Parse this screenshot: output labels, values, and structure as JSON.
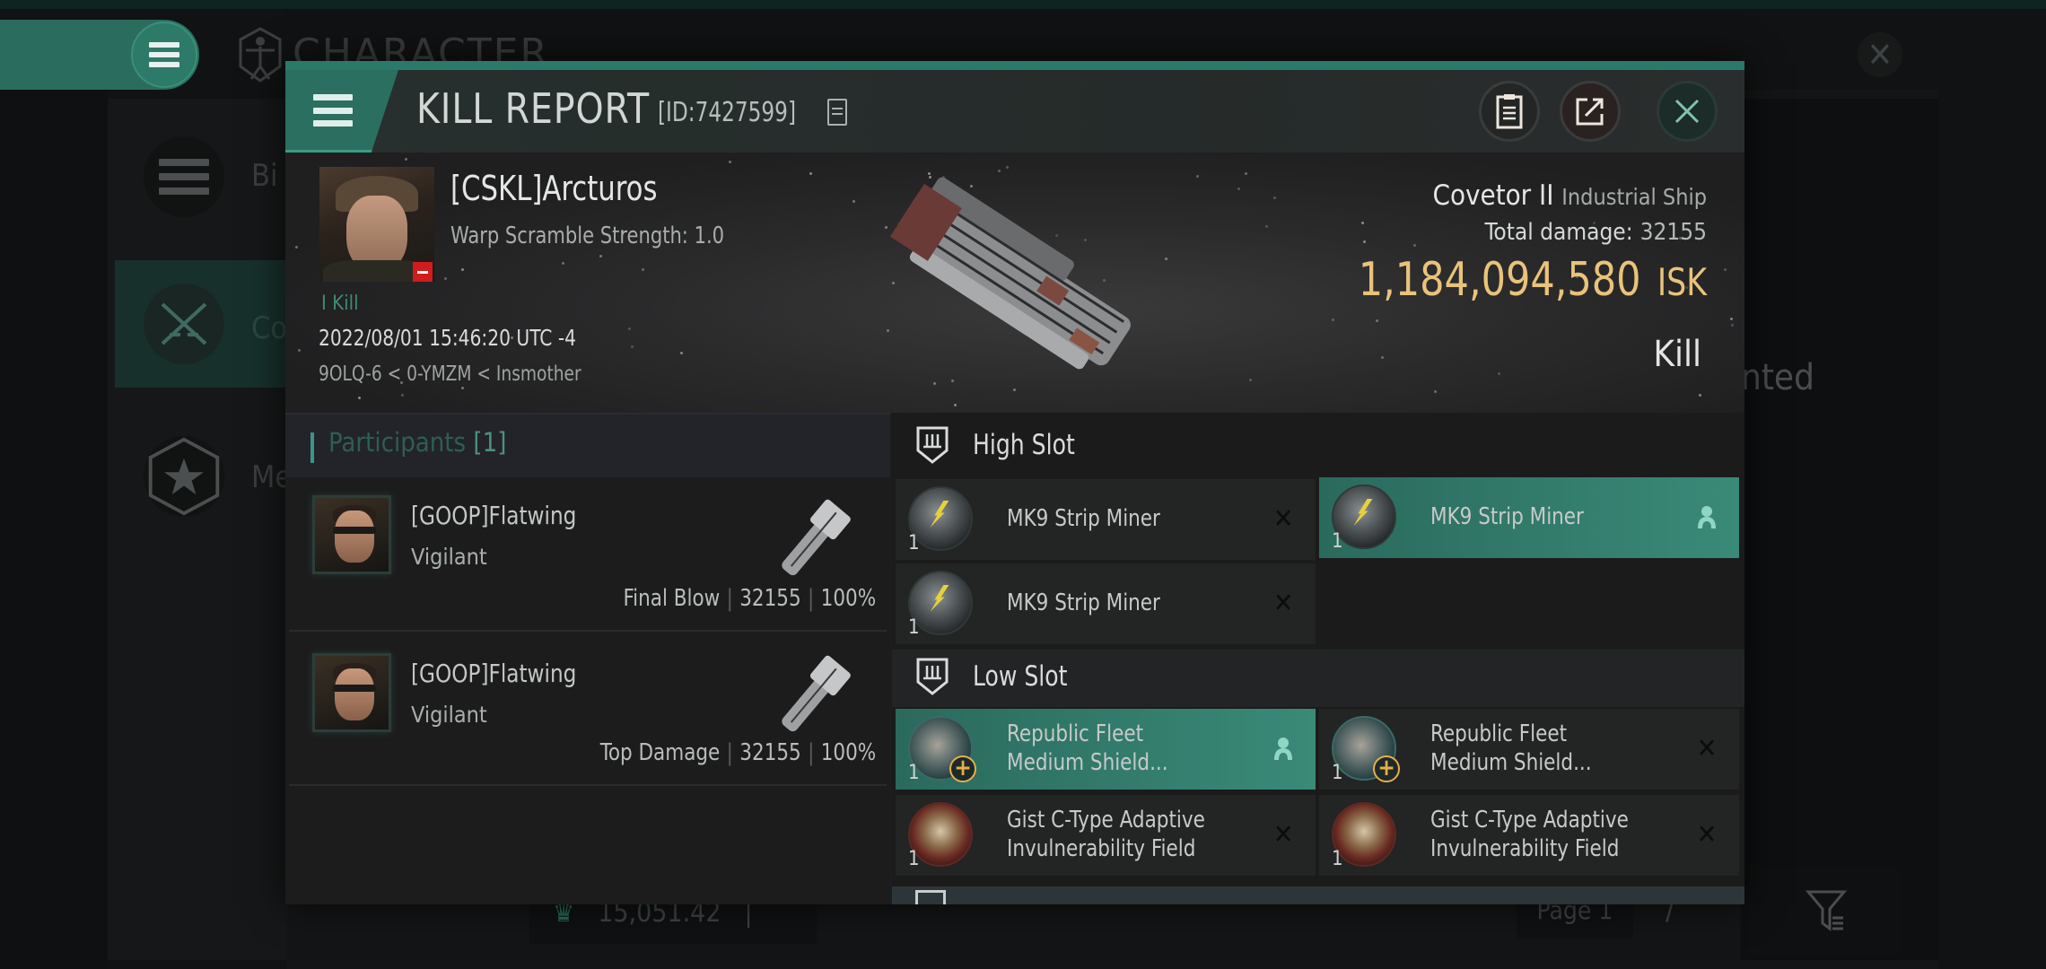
{
  "background": {
    "screen_title": "CHARACTER",
    "sidebar_items": [
      {
        "label": "Bi",
        "icon": "list-icon"
      },
      {
        "label": "Co",
        "icon": "crossed-swords-icon",
        "active": true
      },
      {
        "label": "Me",
        "icon": "star-hexagon-icon"
      }
    ],
    "right_text": "nted",
    "bottom_value": "15,051.42",
    "bottom_divider": "|",
    "page_label": "Page 1",
    "next_arrow": "/"
  },
  "modal": {
    "title": "KILL REPORT",
    "report_id": "[ID:7427599]",
    "buttons": {
      "clipboard": "clipboard-icon",
      "share": "share-icon",
      "close": "close-icon"
    }
  },
  "victim": {
    "name": "[CSKL]Arcturos",
    "warp_scramble": "Warp Scramble Strength: 1.0",
    "kill_count": "I Kill",
    "datetime": "2022/08/01 15:46:20 UTC -4",
    "location": "9OLQ-6 < 0-YMZM < Insmother",
    "security_status_color": "#d01c1c"
  },
  "ship": {
    "name": "Covetor II",
    "class": "Industrial Ship",
    "total_damage_label": "Total damage:",
    "total_damage": "32155",
    "isk_value": "1,184,094,580",
    "isk_unit": "ISK",
    "report_type": "Kill"
  },
  "participants": {
    "title": "Participants",
    "count": "[1]",
    "rows": [
      {
        "name": "[GOOP]Flatwing",
        "ship": "Vigilant",
        "role": "Final Blow",
        "damage": "32155",
        "percent": "100%"
      },
      {
        "name": "[GOOP]Flatwing",
        "ship": "Vigilant",
        "role": "Top Damage",
        "damage": "32155",
        "percent": "100%"
      }
    ]
  },
  "fitting": {
    "high_slot": {
      "label": "High Slot",
      "modules": [
        {
          "name": "MK9 Strip Miner",
          "qty": "1",
          "status": "destroyed",
          "highlight": false
        },
        {
          "name": "MK9 Strip Miner",
          "qty": "1",
          "status": "dropped",
          "highlight": true
        },
        {
          "name": "MK9 Strip Miner",
          "qty": "1",
          "status": "destroyed",
          "highlight": false
        }
      ]
    },
    "low_slot": {
      "label": "Low Slot",
      "modules": [
        {
          "name_line1": "Republic Fleet",
          "name_line2": "Medium Shield...",
          "qty": "1",
          "status": "dropped",
          "highlight": true
        },
        {
          "name_line1": "Republic Fleet",
          "name_line2": "Medium Shield...",
          "qty": "1",
          "status": "destroyed",
          "highlight": false
        },
        {
          "name_line1": "Gist C-Type Adaptive",
          "name_line2": "Invulnerability Field",
          "qty": "1",
          "status": "destroyed",
          "highlight": false
        },
        {
          "name_line1": "Gist C-Type Adaptive",
          "name_line2": "Invulnerability Field",
          "qty": "1",
          "status": "destroyed",
          "highlight": false
        }
      ]
    },
    "status_glyphs": {
      "destroyed": "✕",
      "dropped": "person-icon"
    }
  },
  "colors": {
    "accent": "#2b7a69",
    "isk": "#e9c37a",
    "highlight_row": "#3a8a78"
  }
}
